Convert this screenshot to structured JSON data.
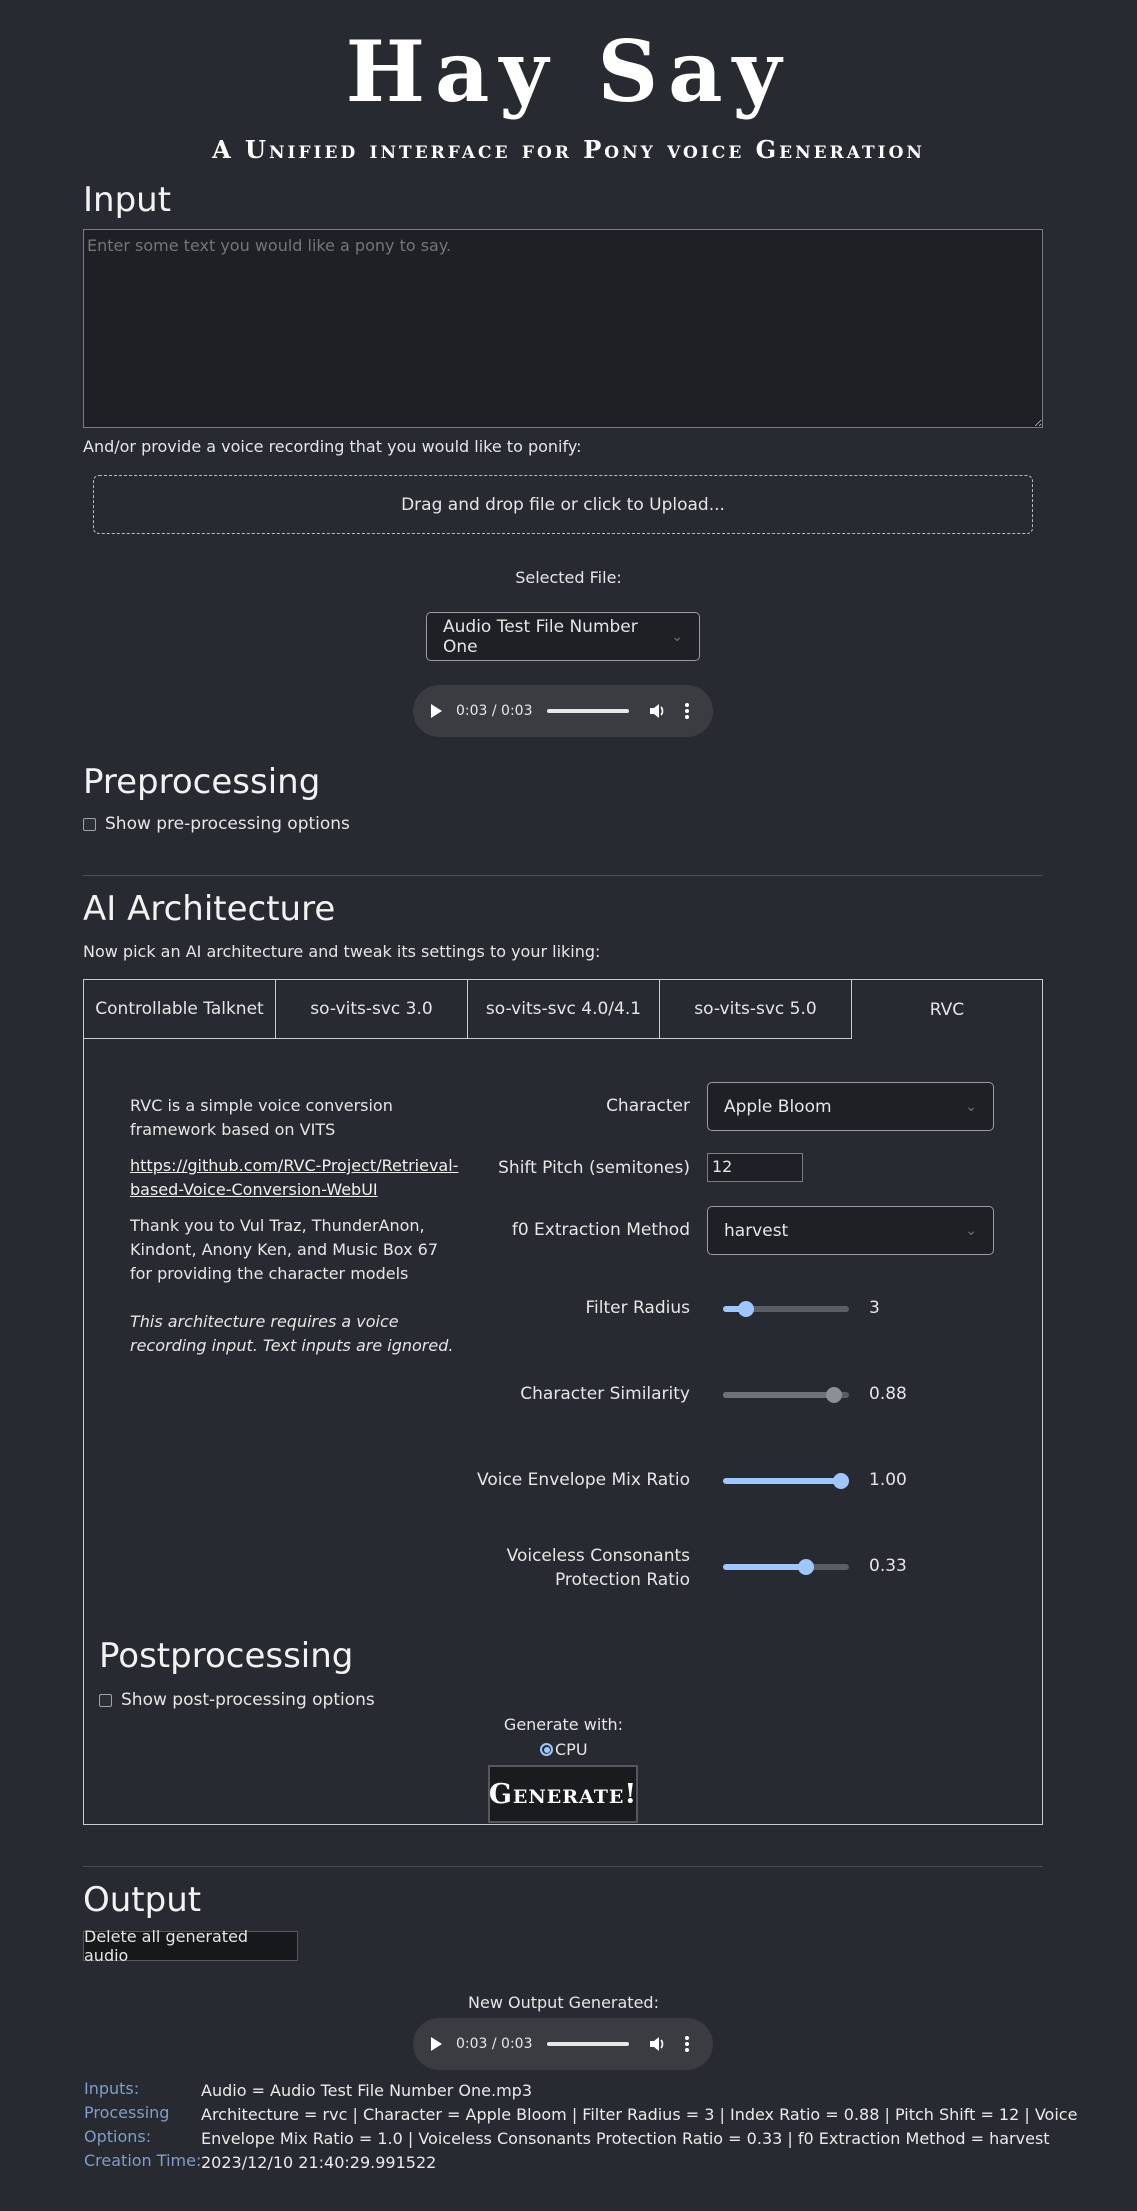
{
  "header": {
    "title": "Hay Say",
    "subtitle": "A Unified interface for Pony voice Generation"
  },
  "input": {
    "heading": "Input",
    "placeholder": "Enter some text you would like a pony to say.",
    "recording_prompt": "And/or provide a voice recording that you would like to ponify:",
    "upload_label": "Drag and drop file or click to Upload...",
    "selected_file_label": "Selected File:",
    "selected_file": "Audio Test File Number One",
    "player_time": "0:03 / 0:03"
  },
  "preprocessing": {
    "heading": "Preprocessing",
    "checkbox_label": "Show pre-processing options"
  },
  "architecture": {
    "heading": "AI Architecture",
    "description": "Now pick an AI architecture and tweak its settings to your liking:",
    "tabs": [
      {
        "label": "Controllable Talknet"
      },
      {
        "label": "so-vits-svc 3.0"
      },
      {
        "label": "so-vits-svc 4.0/4.1"
      },
      {
        "label": "so-vits-svc 5.0"
      },
      {
        "label": "RVC"
      }
    ],
    "active_tab": "RVC",
    "info": {
      "intro": "RVC is a simple voice conversion framework based on VITS",
      "link": "https://github.com/RVC-Project/Retrieval-based-Voice-Conversion-WebUI",
      "thanks": "Thank you to Vul Traz, ThunderAnon, Kindont, Anony Ken, and Music Box 67 for providing the character models",
      "note": "This architecture requires a voice recording input. Text inputs are ignored."
    },
    "settings": {
      "character_label": "Character",
      "character_value": "Apple Bloom",
      "pitch_label": "Shift Pitch (semitones)",
      "pitch_value": "12",
      "f0_label": "f0 Extraction Method",
      "f0_value": "harvest",
      "filter_radius_label": "Filter Radius",
      "filter_radius_value": "3",
      "filter_radius_level": 0.18,
      "similarity_label": "Character Similarity",
      "similarity_value": "0.88",
      "similarity_level": 0.88,
      "envelope_label": "Voice Envelope Mix Ratio",
      "envelope_value": "1.00",
      "envelope_level": 1.0,
      "voiceless_label_1": "Voiceless Consonants",
      "voiceless_label_2": "Protection Ratio",
      "voiceless_value": "0.33",
      "voiceless_level": 0.66
    }
  },
  "postprocessing": {
    "heading": "Postprocessing",
    "checkbox_label": "Show post-processing options",
    "generate_with_label": "Generate with:",
    "device_option": "CPU",
    "generate_button": "Generate!"
  },
  "output": {
    "heading": "Output",
    "delete_button": "Delete all generated audio",
    "new_output_label": "New Output Generated:",
    "player_time": "0:03 / 0:03",
    "inputs_key": "Inputs:",
    "inputs_value": "Audio = Audio Test File Number One.mp3",
    "processing_key_1": "Processing",
    "processing_key_2": "Options:",
    "processing_value_1": "Architecture = rvc | Character = Apple Bloom | Filter Radius = 3 | Index Ratio = 0.88 | Pitch Shift = 12 | Voice",
    "processing_value_2": "Envelope Mix Ratio = 1.0 | Voiceless Consonants Protection Ratio = 0.33 | f0 Extraction Method = harvest",
    "creation_key": "Creation Time:",
    "creation_value": "2023/12/10 21:40:29.991522"
  },
  "colors": {
    "background": "#272a30",
    "accent": "#9fc7ff",
    "meta_key": "#7f9ec8"
  }
}
